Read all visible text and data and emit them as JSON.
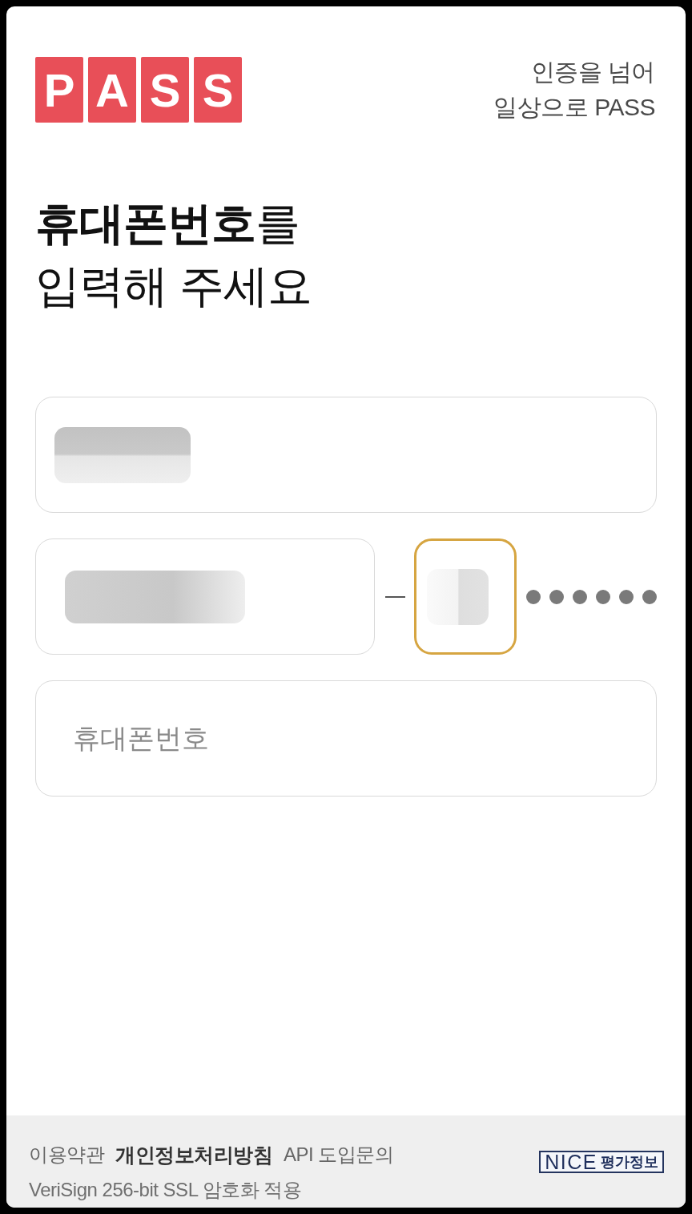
{
  "header": {
    "logo_letters": [
      "P",
      "A",
      "S",
      "S"
    ],
    "tagline": [
      "인증을 넘어",
      "일상으로 PASS"
    ]
  },
  "heading": [
    "**휴대폰번호**를",
    "입력해 주세요"
  ],
  "name_field": {
    "redacted": true,
    "focused": false
  },
  "id_row": {
    "birth_field": {
      "redacted": true,
      "focused": false
    },
    "gender_field": {
      "redacted": true,
      "focused": true
    },
    "hidden_digits": [
      {
        "filled": true
      },
      {
        "filled": true
      },
      {
        "filled": true
      },
      {
        "filled": true
      },
      {
        "filled": true
      },
      {
        "filled": true
      }
    ]
  },
  "phone_field": {
    "placeholder": "휴대폰번호",
    "redacted": false,
    "focused": false
  },
  "footer": {
    "links": [
      {
        "label": "이용약관",
        "emphasized": false
      },
      {
        "label": "개인정보처리방침",
        "emphasized": true
      },
      {
        "label": "API 도입문의",
        "emphasized": false
      }
    ],
    "security_note": "VeriSign 256-bit SSL 암호화 적용",
    "partner_logo": {
      "name": "NICE",
      "subtitle": "평가정보"
    }
  }
}
